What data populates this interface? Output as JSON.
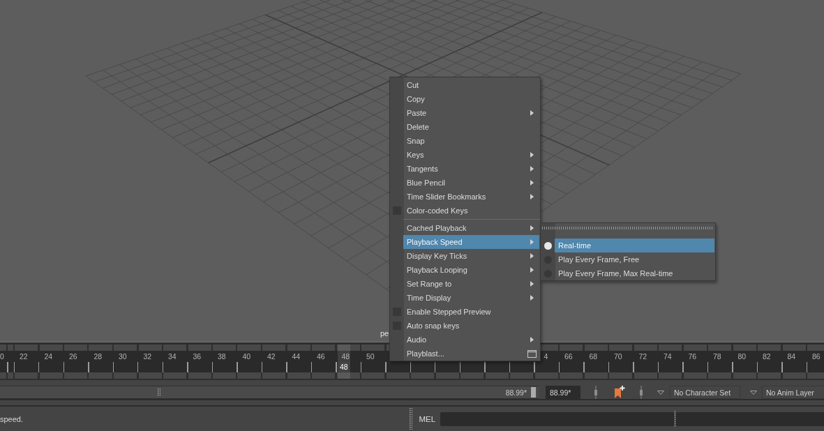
{
  "viewport": {
    "camera_label": "pe"
  },
  "context_menu": {
    "items": [
      {
        "kind": "command",
        "label": "Cut",
        "selected": false
      },
      {
        "kind": "command",
        "label": "Copy",
        "selected": false
      },
      {
        "kind": "submenu",
        "label": "Paste",
        "selected": false
      },
      {
        "kind": "command",
        "label": "Delete",
        "selected": false
      },
      {
        "kind": "command",
        "label": "Snap",
        "selected": false
      },
      {
        "kind": "submenu",
        "label": "Keys",
        "selected": false
      },
      {
        "kind": "submenu",
        "label": "Tangents",
        "selected": false
      },
      {
        "kind": "submenu",
        "label": "Blue Pencil",
        "selected": false
      },
      {
        "kind": "submenu",
        "label": "Time Slider Bookmarks",
        "selected": false
      },
      {
        "kind": "checkbox",
        "label": "Color-coded Keys",
        "checked": false,
        "selected": false
      },
      {
        "kind": "separator"
      },
      {
        "kind": "submenu",
        "label": "Cached Playback",
        "selected": false
      },
      {
        "kind": "submenu",
        "label": "Playback Speed",
        "selected": true
      },
      {
        "kind": "submenu",
        "label": "Display Key Ticks",
        "selected": false
      },
      {
        "kind": "submenu",
        "label": "Playback Looping",
        "selected": false
      },
      {
        "kind": "submenu",
        "label": "Set Range to",
        "selected": false
      },
      {
        "kind": "submenu",
        "label": "Time Display",
        "selected": false
      },
      {
        "kind": "checkbox",
        "label": "Enable Stepped Preview",
        "checked": false,
        "selected": false
      },
      {
        "kind": "checkbox",
        "label": "Auto snap keys",
        "checked": false,
        "selected": false
      },
      {
        "kind": "submenu",
        "label": "Audio",
        "selected": false
      },
      {
        "kind": "option",
        "label": "Playblast...",
        "selected": false
      }
    ]
  },
  "submenu": {
    "tear_off": true,
    "items": [
      {
        "label": "Real-time",
        "checked": true,
        "selected": true
      },
      {
        "label": "Play Every Frame, Free",
        "checked": false,
        "selected": false
      },
      {
        "label": "Play Every Frame, Max Real-time",
        "checked": false,
        "selected": false
      }
    ]
  },
  "time_slider": {
    "labels_left": [
      {
        "label": "0",
        "selected": false
      },
      {
        "label": "22",
        "selected": false
      },
      {
        "label": "24",
        "selected": false
      },
      {
        "label": "26",
        "selected": false
      },
      {
        "label": "28",
        "selected": false
      },
      {
        "label": "30",
        "selected": false
      },
      {
        "label": "32",
        "selected": false
      },
      {
        "label": "34",
        "selected": false
      },
      {
        "label": "36",
        "selected": false
      },
      {
        "label": "38",
        "selected": false
      },
      {
        "label": "40",
        "selected": false
      },
      {
        "label": "42",
        "selected": false
      },
      {
        "label": "44",
        "selected": false
      },
      {
        "label": "46",
        "selected": false
      },
      {
        "label": "48",
        "selected": true
      },
      {
        "label": "50",
        "selected": false
      }
    ],
    "labels_right": [
      {
        "label": "4",
        "selected": false
      },
      {
        "label": "66",
        "selected": false
      },
      {
        "label": "68",
        "selected": false
      },
      {
        "label": "70",
        "selected": false
      },
      {
        "label": "72",
        "selected": false
      },
      {
        "label": "74",
        "selected": false
      },
      {
        "label": "76",
        "selected": false
      },
      {
        "label": "78",
        "selected": false
      },
      {
        "label": "80",
        "selected": false
      },
      {
        "label": "82",
        "selected": false
      },
      {
        "label": "84",
        "selected": false
      },
      {
        "label": "86",
        "selected": false
      }
    ],
    "current_frame": "48"
  },
  "range_slider": {
    "end_label": "88.99*",
    "level": 0.99
  },
  "playback_end_field": {
    "value": "88.99*"
  },
  "character_set": {
    "value": "No Character Set"
  },
  "anim_layer": {
    "value": "No Anim Layer"
  },
  "status_bar": {
    "help_line": "speed.",
    "command_language": "MEL"
  }
}
